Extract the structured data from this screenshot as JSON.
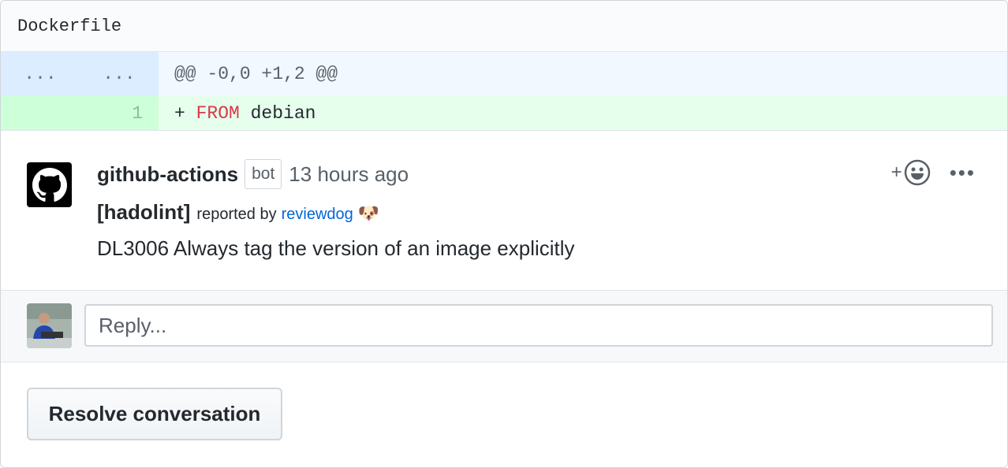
{
  "file": {
    "name": "Dockerfile"
  },
  "hunk": {
    "old_num": "...",
    "new_num": "...",
    "header": "@@ -0,0 +1,2 @@"
  },
  "added_line": {
    "line_num": "1",
    "prefix": "+ ",
    "keyword": "FROM",
    "rest": " debian"
  },
  "comment": {
    "author": "github-actions",
    "badge": "bot",
    "timestamp": "13 hours ago",
    "tool": "[hadolint]",
    "reported_by": "reported by",
    "reporter_link": "reviewdog",
    "reporter_emoji": "🐶",
    "message": "DL3006 Always tag the version of an image explicitly",
    "add_reaction": "+",
    "more_menu": "•••"
  },
  "reply": {
    "placeholder": "Reply..."
  },
  "resolve_button": "Resolve conversation",
  "colors": {
    "accent": "#0366d6",
    "keyword": "#d73a49",
    "added_bg": "#e6ffed",
    "hunk_bg": "#f1f8ff"
  }
}
